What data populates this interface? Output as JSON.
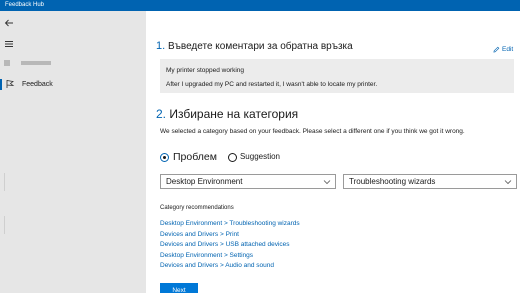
{
  "window": {
    "title": "Feedback Hub"
  },
  "sidebar": {
    "feedback_label": "Feedback"
  },
  "step1": {
    "number": "1.",
    "heading": "Въведете коментари за обратна връзка",
    "edit_label": "Edit",
    "summary": "My printer stopped working",
    "detail": "After I upgraded my PC and restarted it, I wasn't able to locate my printer."
  },
  "step2": {
    "number": "2.",
    "heading": "Избиране на категория",
    "description": "We selected a category based on your feedback. Please select a different one if you think we got it wrong.",
    "radio_problem": "Проблем",
    "radio_suggestion": "Suggestion",
    "selected_type": "problem",
    "dropdown_category": "Desktop Environment",
    "dropdown_subcategory": "Troubleshooting wizards"
  },
  "recommendations": {
    "title": "Category recommendations",
    "items": [
      "Desktop Environment > Troubleshooting wizards",
      "Devices and Drivers > Print",
      "Devices and Drivers > USB attached devices",
      "Desktop Environment > Settings",
      "Devices and Drivers > Audio and sound"
    ]
  },
  "next_label": "Next",
  "colors": {
    "accent": "#0063b1",
    "button": "#0078d7",
    "sidebar_bg": "#e6e6e6",
    "feedback_box_bg": "#ececec"
  },
  "icons": {
    "back": "back-arrow-icon",
    "menu": "hamburger-menu-icon",
    "feedback": "feedback-icon",
    "edit": "pencil-icon",
    "dropdown": "chevron-down-icon"
  }
}
